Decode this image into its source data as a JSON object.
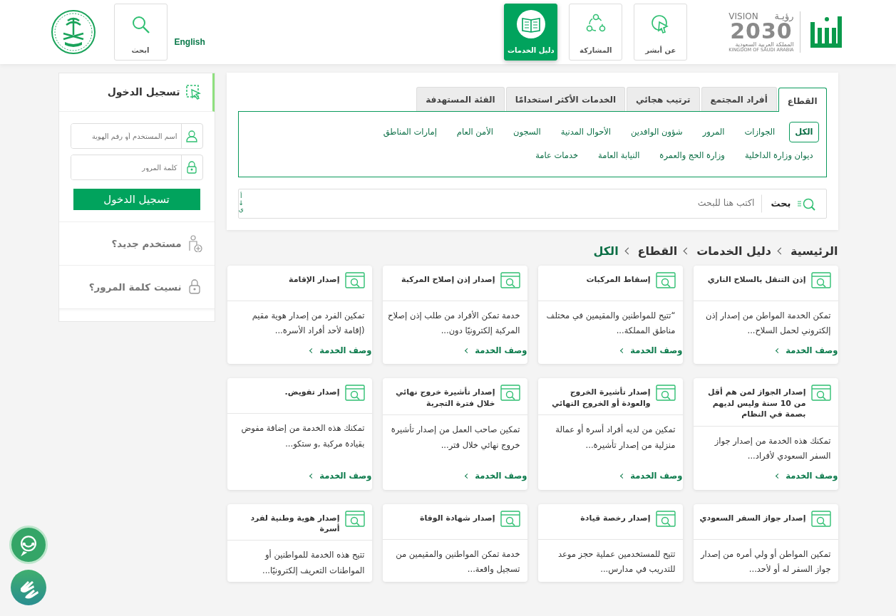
{
  "header": {
    "vision": {
      "arabic": "رؤيـة",
      "latin": "VISION",
      "year": "2030",
      "country_ar": "المملكة العربية السعودية",
      "country_en": "KINGDOM OF SAUDI ARABIA"
    },
    "nav": [
      {
        "label": "عن أبشر",
        "kind": "pointer",
        "selected": false
      },
      {
        "label": "المشاركة",
        "kind": "share",
        "selected": false
      },
      {
        "label": "دليل الخدمات",
        "kind": "book",
        "selected": true
      }
    ],
    "language": "English",
    "search_button": "ابحث"
  },
  "filters": {
    "tabs": [
      {
        "label": "القطاع",
        "selected": true
      },
      {
        "label": "أفراد المجتمع",
        "selected": false
      },
      {
        "label": "ترتيب هجائي",
        "selected": false
      },
      {
        "label": "الخدمات الأكثر استخدامًا",
        "selected": false
      },
      {
        "label": "الفئة المستهدفة",
        "selected": false
      }
    ],
    "sectors": [
      {
        "label": "الكل",
        "selected": true
      },
      {
        "label": "الجوازات",
        "selected": false
      },
      {
        "label": "المرور",
        "selected": false
      },
      {
        "label": "شؤون الوافدين",
        "selected": false
      },
      {
        "label": "الأحوال المدنية",
        "selected": false
      },
      {
        "label": "السجون",
        "selected": false
      },
      {
        "label": "الأمن العام",
        "selected": false
      },
      {
        "label": "إمارات المناطق",
        "selected": false
      },
      {
        "label": "ديوان وزارة الداخلية",
        "selected": false
      },
      {
        "label": "وزارة الحج والعمرة",
        "selected": false
      },
      {
        "label": "النيابة العامة",
        "selected": false
      },
      {
        "label": "خدمات عامة",
        "selected": false
      }
    ],
    "search": {
      "button": "بحث",
      "placeholder": "اكتب هنا للبحث",
      "sort": [
        "أ",
        "↓",
        "ي"
      ]
    }
  },
  "breadcrumb": [
    "الرئيسية",
    "دليل الخدمات",
    "القطاع",
    "الكل"
  ],
  "login": {
    "title": "تسجيل الدخول",
    "username_placeholder": "اسم المستخدم أو رقم الهوية",
    "password_placeholder": "كلمة المرور",
    "button": "تسجيل الدخول",
    "links": [
      {
        "label": "مستخدم جديد؟",
        "kind": "new_user"
      },
      {
        "label": "نسيت كلمة المرور؟",
        "kind": "forgot"
      }
    ]
  },
  "services": [
    {
      "title": "إذن التنقل بالسلاح الناري",
      "description": "تمكن الخدمة المواطن من إصدار إذن إلكتروني لحمل السلاح...",
      "link": "وصف الخدمة"
    },
    {
      "title": "إسقاط المركبات",
      "description": "“تتيح للمواطنين والمقيمين في مختلف مناطق المملكة...",
      "link": "وصف الخدمة"
    },
    {
      "title": "إصدار إذن إصلاح المركبة",
      "description": "خدمة تمكن الأفراد من طلب إذن إصلاح المركبة إلكترونيًا دون...",
      "link": "وصف الخدمة"
    },
    {
      "title": "إصدار الإقامة",
      "description": "تمكين الفرد من إصدار هوية مقيم (إقامة لأحد أفراد الأسرة...",
      "link": "وصف الخدمة"
    },
    {
      "title": "إصدار الجواز لمن هم أقل من 10 سنة وليس لديهم بصمة في النظام",
      "description": "تمكنك هذه الخدمة من إصدار جواز السفر السعودي لأفراد...",
      "link": "وصف الخدمة"
    },
    {
      "title": "إصدار تأشيرة الخروج والعودة أو الخروج النهائي",
      "description": "تمكين من لديه أفراد أسرة أو عمالة منزلية من إصدار تأشيرة...",
      "link": "وصف الخدمة"
    },
    {
      "title": "إصدار تأشيرة خروج نهائي خلال فترة التجربة",
      "description": "تمكين صاحب العمل من إصدار تأشيرة خروج نهائي خلال فتر...",
      "link": "وصف الخدمة"
    },
    {
      "title": "إصدار تفويض.",
      "description": "تمكنك هذه الخدمة من إضافة مفوض بقيادة مركبة ,و ستكو...",
      "link": "وصف الخدمة"
    },
    {
      "title": "إصدار جواز السفر السعودي",
      "description": "تمكين المواطن أو ولي أمره من إصدار جواز السفر له أو لأحد..."
    },
    {
      "title": "إصدار رخصة قيادة",
      "description": "تتيح للمستخدمين عملية حجز موعد للتدريب في مدارس..."
    },
    {
      "title": "إصدار شهادة الوفاة",
      "description": "خدمة تمكن المواطنين والمقيمين من تسجيل واقعة..."
    },
    {
      "title": "إصدار هوية وطنية لفرد أسرة",
      "description": "تتيح هذه الخدمة للمواطنين أو المواطنات التعريف إلكترونيًا..."
    }
  ]
}
